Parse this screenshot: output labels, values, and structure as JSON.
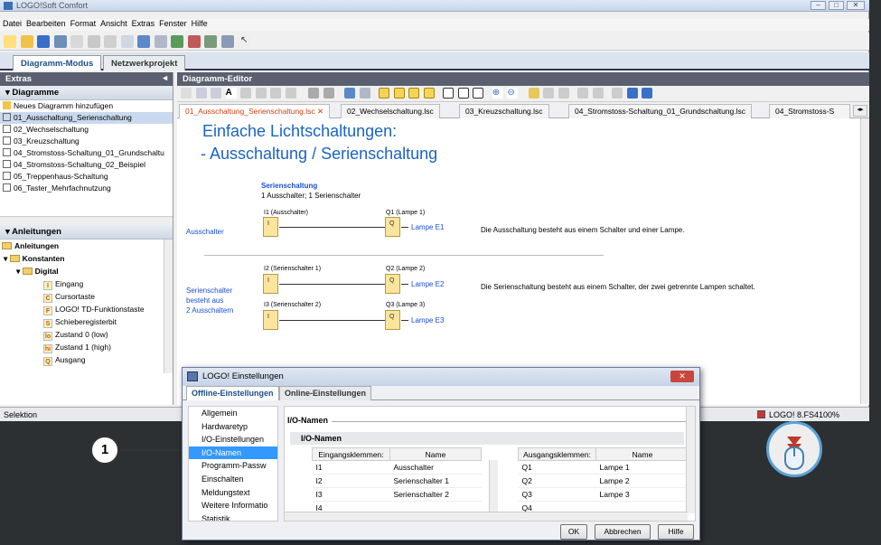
{
  "app": {
    "title": "LOGO!Soft Comfort",
    "menu": [
      "Datei",
      "Bearbeiten",
      "Format",
      "Ansicht",
      "Extras",
      "Fenster",
      "Hilfe"
    ],
    "mode_tabs": [
      "Diagramm-Modus",
      "Netzwerkprojekt"
    ]
  },
  "left": {
    "header": "Extras",
    "diagrams_header": "Diagramme",
    "diagrams": [
      "Neues Diagramm hinzufügen",
      "01_Ausschaltung_Serienschaltung",
      "02_Wechselschaltung",
      "03_Kreuzschaltung",
      "04_Stromstoss-Schaltung_01_Grundschaltu",
      "04_Stromstoss-Schaltung_02_Beispiel",
      "05_Treppenhaus-Schaltung",
      "06_Taster_Mehrfachnutzung"
    ],
    "anleitungen_header": "Anleitungen",
    "tree": {
      "root": "Anleitungen",
      "konstanten": "Konstanten",
      "digital": "Digital",
      "items": [
        {
          "badge": "I",
          "label": "Eingang"
        },
        {
          "badge": "C",
          "label": "Cursortaste"
        },
        {
          "badge": "F",
          "label": "LOGO! TD-Funktionstaste"
        },
        {
          "badge": "S",
          "label": "Schieberegisterbit"
        },
        {
          "badge": "lo",
          "label": "Zustand 0 (low)"
        },
        {
          "badge": "hi",
          "label": "Zustand 1 (high)"
        },
        {
          "badge": "Q",
          "label": "Ausgang"
        }
      ]
    }
  },
  "editor": {
    "header": "Diagramm-Editor",
    "tabs": [
      "01_Ausschaltung_Serienschaltung.lsc",
      "02_Wechselschaltung.lsc",
      "03_Kreuzschaltung.lsc",
      "04_Stromstoss-Schaltung_01_Grundschaltung.lsc",
      "04_Stromstoss-S"
    ],
    "heading1": "Einfache Lichtschaltungen:",
    "heading2": "- Ausschaltung / Serienschaltung",
    "sub_title": "Serienschaltung",
    "sub_text": "1 Ausschalter; 1 Serienschalter",
    "row1": {
      "side": "Ausschalter",
      "in_lbl": "I1 (Ausschalter)",
      "out_lbl": "Q1 (Lampe 1)",
      "lamp": "Lampe E1",
      "desc": "Die Ausschaltung besteht aus einem Schalter und einer Lampe."
    },
    "row2": {
      "side1": "Serienschalter",
      "side2": "besteht aus",
      "side3": "2 Ausschaltern",
      "in_lbl": "I2 (Serienschalter 1)",
      "out_lbl": "Q2 (Lampe 2)",
      "lamp": "Lampe E2",
      "desc": "Die Serienschaltung besteht aus einem Schalter, der zwei getrennte Lampen schaltet."
    },
    "row3": {
      "in_lbl": "I3 (Serienschalter 2)",
      "out_lbl": "Q3 (Lampe 3)",
      "lamp": "Lampe E3"
    },
    "block_i": "I",
    "block_q": "Q"
  },
  "status": {
    "left": "Selektion",
    "device": "LOGO! 8.FS4",
    "zoom": "100%"
  },
  "dialog": {
    "title": "LOGO! Einstellungen",
    "tabs": [
      "Offline-Einstellungen",
      "Online-Einstellungen"
    ],
    "nav": [
      "Allgemein",
      "Hardwaretyp",
      "I/O-Einstellungen",
      "I/O-Namen",
      "Programm-Passw",
      "Einschalten",
      "Meldungstext",
      "Weitere Informatio",
      "Statistik"
    ],
    "section": "I/O-Namen",
    "subsection": "I/O-Namen",
    "in_headers": [
      "Eingangsklemmen:",
      "Name"
    ],
    "inputs": [
      [
        "I1",
        "Ausschalter"
      ],
      [
        "I2",
        "Serienschalter 1"
      ],
      [
        "I3",
        "Serienschalter 2"
      ],
      [
        "I4",
        ""
      ]
    ],
    "out_headers": [
      "Ausgangsklemmen:",
      "Name"
    ],
    "outputs": [
      [
        "Q1",
        "Lampe 1"
      ],
      [
        "Q2",
        "Lampe 2"
      ],
      [
        "Q3",
        "Lampe 3"
      ],
      [
        "Q4",
        ""
      ]
    ],
    "buttons": [
      "OK",
      "Abbrechen",
      "Hilfe"
    ]
  },
  "callout": "1"
}
